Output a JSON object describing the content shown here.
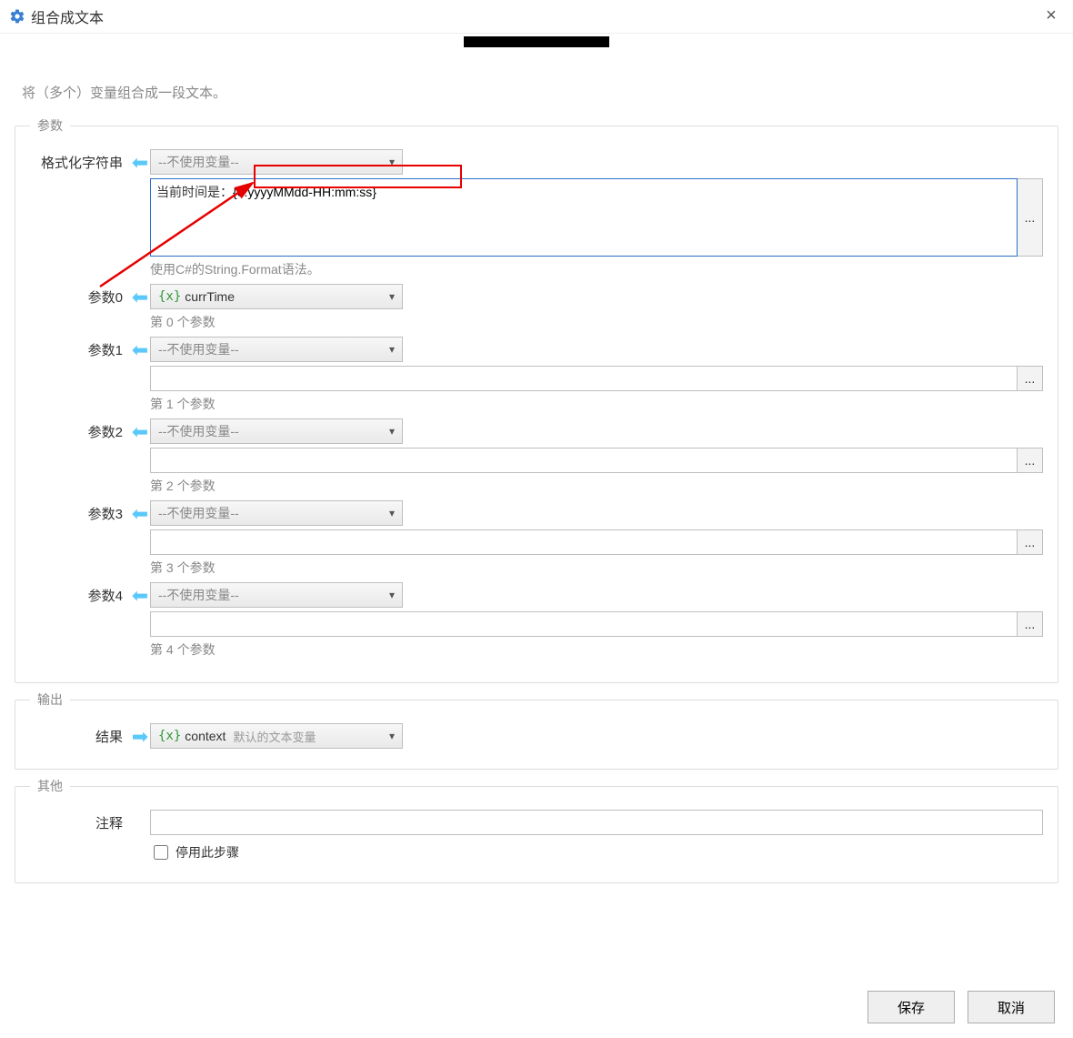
{
  "window": {
    "title": "组合成文本"
  },
  "description": "将（多个）变量组合成一段文本。",
  "sections": {
    "params_legend": "参数",
    "output_legend": "输出",
    "other_legend": "其他"
  },
  "format": {
    "label": "格式化字符串",
    "var_select_placeholder": "--不使用变量--",
    "value_prefix": "当前时间是：",
    "value_pattern": "{0:yyyyMMdd-HH:mm:ss}",
    "hint": "使用C#的String.Format语法。"
  },
  "params": [
    {
      "label": "参数0",
      "var_text": "currTime",
      "var_is_set": true,
      "hint": "第 0 个参数"
    },
    {
      "label": "参数1",
      "var_text": "--不使用变量--",
      "var_is_set": false,
      "hint": "第 1 个参数"
    },
    {
      "label": "参数2",
      "var_text": "--不使用变量--",
      "var_is_set": false,
      "hint": "第 2 个参数"
    },
    {
      "label": "参数3",
      "var_text": "--不使用变量--",
      "var_is_set": false,
      "hint": "第 3 个参数"
    },
    {
      "label": "参数4",
      "var_text": "--不使用变量--",
      "var_is_set": false,
      "hint": "第 4 个参数"
    }
  ],
  "output": {
    "label": "结果",
    "var_text": "context",
    "var_default_text": "默认的文本变量"
  },
  "other": {
    "comment_label": "注释",
    "comment_value": "",
    "disable_label": "停用此步骤",
    "disable_checked": false
  },
  "footer": {
    "save": "保存",
    "cancel": "取消"
  },
  "more_btn": "..."
}
